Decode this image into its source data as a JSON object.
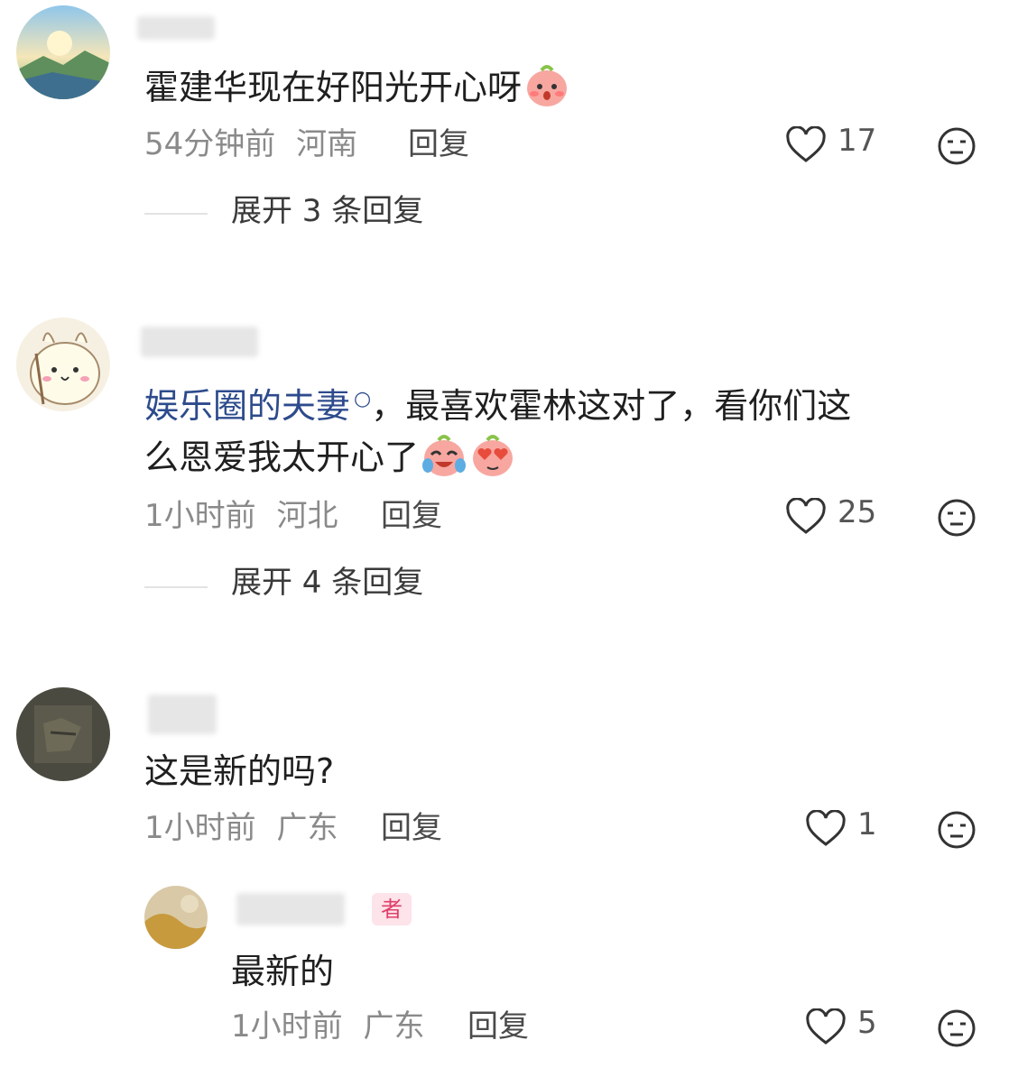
{
  "comments": [
    {
      "text": "霍建华现在好阳光开心呀",
      "emoji": [
        "shy-face-emoji"
      ],
      "time": "54分钟前",
      "location": "河南",
      "reply_label": "回复",
      "likes": "17",
      "expand_label": "展开 3 条回复"
    },
    {
      "text_link": "娱乐圈的夫妻",
      "text_rest_line1": "，最喜欢霍林这对了，看你们这",
      "text_line2": "么恩爱我太开心了",
      "emoji": [
        "crying-laughing-emoji",
        "heart-eyes-emoji"
      ],
      "time": "1小时前",
      "location": "河北",
      "reply_label": "回复",
      "likes": "25",
      "expand_label": "展开 4 条回复"
    },
    {
      "text": "这是新的吗?",
      "time": "1小时前",
      "location": "广东",
      "reply_label": "回复",
      "likes": "1",
      "reply": {
        "badge": "者",
        "text": "最新的",
        "time": "1小时前",
        "location": "广东",
        "reply_label": "回复",
        "likes": "5"
      }
    }
  ],
  "colors": {
    "link": "#2d4b8c",
    "meta": "#8a8a8a",
    "badge_bg": "#fde3ea",
    "badge_text": "#e0406a"
  },
  "icons": {
    "like": "heart-outline-icon",
    "dislike": "neutral-face-icon"
  }
}
